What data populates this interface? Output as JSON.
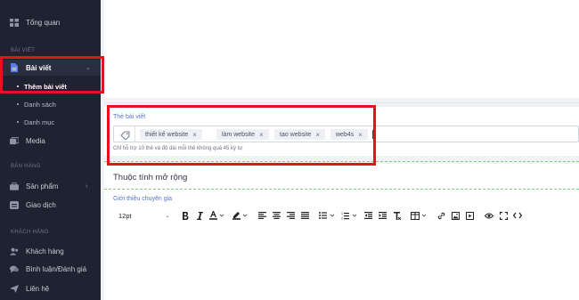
{
  "sidebar": {
    "overview": "Tổng quan",
    "section_posts": "BÀI VIẾT",
    "posts": "Bài viết",
    "add_post": "Thêm bài viết",
    "list": "Danh sách",
    "category": "Danh mục",
    "media": "Media",
    "section_sales": "BÁN HÀNG",
    "products": "Sản phẩm",
    "transactions": "Giao dịch",
    "section_customers": "KHÁCH HÀNG",
    "customers": "Khách hàng",
    "reviews": "Bình luận/Đánh giá",
    "contact": "Liên hệ"
  },
  "tags_field": {
    "label": "Thẻ bài viết",
    "tags": [
      "thiết kế website",
      "làm website",
      "tạo website",
      "web4s"
    ],
    "hint": "Chỉ hỗ trợ 10 thẻ và độ dài mỗi thẻ không quá 45 ký tự"
  },
  "extended": {
    "heading": "Thuộc tính mở rộng",
    "intro_label": "Giới thiệu chuyên gia"
  },
  "editor": {
    "font_size": "12pt"
  },
  "colors": {
    "highlight": "#e0141e",
    "sidebar_bg": "#1f2230",
    "label_blue": "#5a74c7"
  }
}
